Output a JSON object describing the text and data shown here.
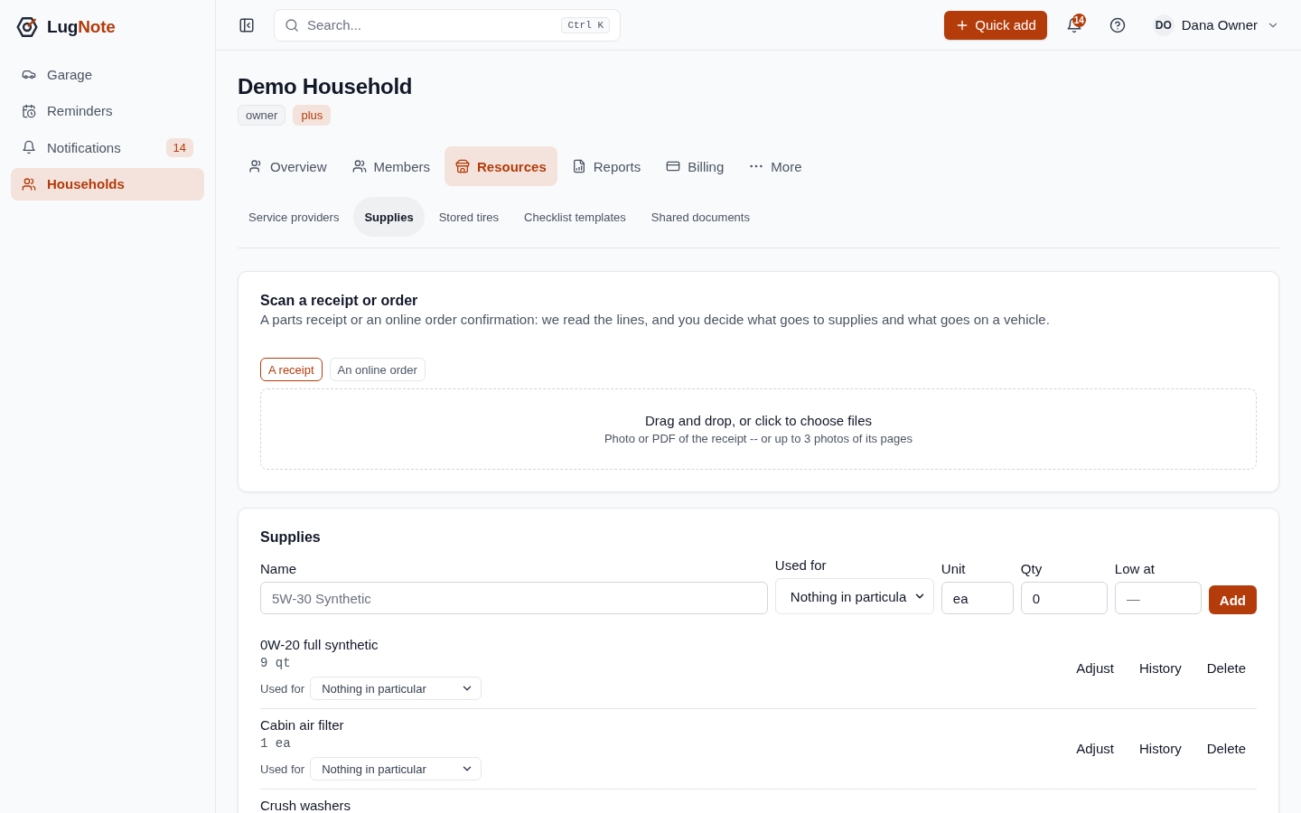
{
  "sidebar": {
    "brand": {
      "name_start": "Lug",
      "name_end": "Note"
    },
    "items": [
      {
        "label": "Garage",
        "selected": false
      },
      {
        "label": "Reminders",
        "selected": false
      },
      {
        "label": "Notifications",
        "badge": "14",
        "selected": false
      },
      {
        "label": "Households",
        "selected": true
      }
    ]
  },
  "top_bar": {
    "search": {
      "placeholder": "Search...",
      "shortcut": "Ctrl K"
    },
    "quick_add": "Quick add",
    "notification_count": "14",
    "user": {
      "initials": "DO",
      "name": "Dana Owner"
    }
  },
  "page": {
    "title": "Demo Household",
    "badges": [
      {
        "label": "owner",
        "kind": "neutral"
      },
      {
        "label": "plus",
        "kind": "accent"
      }
    ],
    "tabs": [
      {
        "label": "Overview",
        "selected": false
      },
      {
        "label": "Members",
        "selected": false
      },
      {
        "label": "Resources",
        "selected": true
      },
      {
        "label": "Reports",
        "selected": false
      },
      {
        "label": "Billing",
        "selected": false
      },
      {
        "label": "More",
        "selected": false
      }
    ],
    "subtabs": [
      {
        "label": "Service providers",
        "selected": false
      },
      {
        "label": "Supplies",
        "selected": true
      },
      {
        "label": "Stored tires",
        "selected": false
      },
      {
        "label": "Checklist templates",
        "selected": false
      },
      {
        "label": "Shared documents",
        "selected": false
      }
    ]
  },
  "scan_card": {
    "title": "Scan a receipt or order",
    "description": "A parts receipt or an online order confirmation: we read the lines, and you decide what goes to supplies and what goes on a vehicle.",
    "modes": [
      {
        "label": "A receipt",
        "selected": true
      },
      {
        "label": "An online order",
        "selected": false
      }
    ],
    "dropzone": {
      "title": "Drag and drop, or click to choose files",
      "hint": "Photo or PDF of the receipt -- or up to 3 photos of its pages"
    }
  },
  "supplies_card": {
    "title": "Supplies",
    "form": {
      "fields": [
        {
          "kind": "text",
          "label": "Name",
          "placeholder": "5W-30 Synthetic"
        },
        {
          "kind": "select",
          "label": "Used for",
          "value": "Nothing in particula"
        },
        {
          "kind": "text",
          "label": "Unit",
          "value": "ea"
        },
        {
          "kind": "text",
          "label": "Qty",
          "value": "0"
        },
        {
          "kind": "text",
          "label": "Low at",
          "placeholder": "—"
        }
      ],
      "submit": "Add"
    },
    "items": [
      {
        "name": "0W-20 full synthetic",
        "quantity": "9 qt",
        "used_for_label": "Used for",
        "used_for": "Nothing in particular",
        "actions": [
          "Adjust",
          "History",
          "Delete"
        ]
      },
      {
        "name": "Cabin air filter",
        "quantity": "1 ea",
        "used_for_label": "Used for",
        "used_for": "Nothing in particular",
        "actions": [
          "Adjust",
          "History",
          "Delete"
        ]
      },
      {
        "name": "Crush washers"
      }
    ]
  }
}
